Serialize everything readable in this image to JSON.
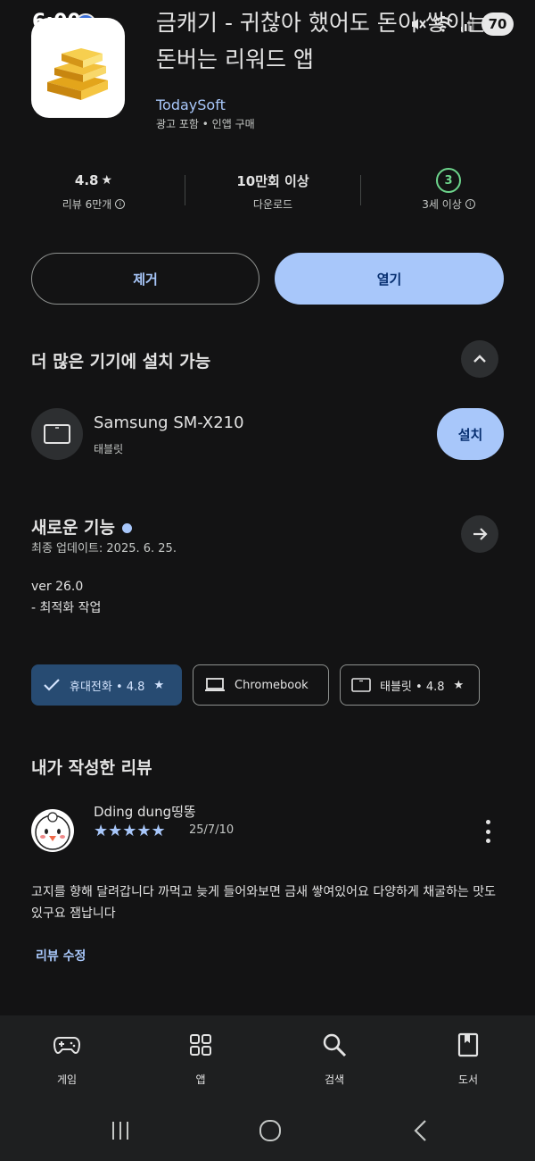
{
  "status": {
    "time": "6:00",
    "battery": "70"
  },
  "app": {
    "title_line1": "금캐기 - 귀찮아 했어도 돈이 쌓이는",
    "title_line2": "돈버는 리워드 앱",
    "developer": "TodaySoft",
    "meta": "광고 포함 • 인앱 구매"
  },
  "stats": {
    "rating": "4.8",
    "rating_star": "★",
    "reviews_label": "리뷰 6만개",
    "downloads": "10만회 이상",
    "downloads_label": "다운로드",
    "age_value": "3",
    "age_label": "3세 이상"
  },
  "actions": {
    "uninstall": "제거",
    "open": "열기"
  },
  "more_devices": {
    "title": "더 많은 기기에 설치 가능",
    "device_name": "Samsung SM-X210",
    "device_type": "태블릿",
    "install": "설치"
  },
  "whats_new": {
    "title": "새로운 기능",
    "updated": "최종 업데이트: 2025. 6. 25.",
    "line1": "ver 26.0",
    "line2": "- 최적화 작업"
  },
  "chips": [
    {
      "label": "휴대전화 • 4.8",
      "icon": "check-icon",
      "star": "★",
      "selected": true
    },
    {
      "label": "Chromebook",
      "icon": "laptop-icon",
      "star": "",
      "selected": false
    },
    {
      "label": "태블릿 • 4.8",
      "icon": "tablet-icon",
      "star": "★",
      "selected": false
    }
  ],
  "my_review": {
    "title": "내가 작성한 리뷰",
    "reviewer": "Dding dung띵똥",
    "stars": "★★★★★",
    "date": "25/7/10",
    "text": "고지를 향해 달려갑니다 까먹고 늦게 들어와보면 금새 쌓여있어요 다양하게 채굴하는 맛도 있구요 잼납니다",
    "edit": "리뷰 수정"
  },
  "bottom_nav": [
    {
      "label": "게임",
      "icon": "gamepad-icon"
    },
    {
      "label": "앱",
      "icon": "apps-grid-icon"
    },
    {
      "label": "검색",
      "icon": "search-icon"
    },
    {
      "label": "도서",
      "icon": "book-icon"
    }
  ],
  "colors": {
    "background": "#131314",
    "accent": "#a8c7fa",
    "accent_text": "#062e6f",
    "chip_selected": "#274b72",
    "age_badge": "#6dd58c"
  }
}
